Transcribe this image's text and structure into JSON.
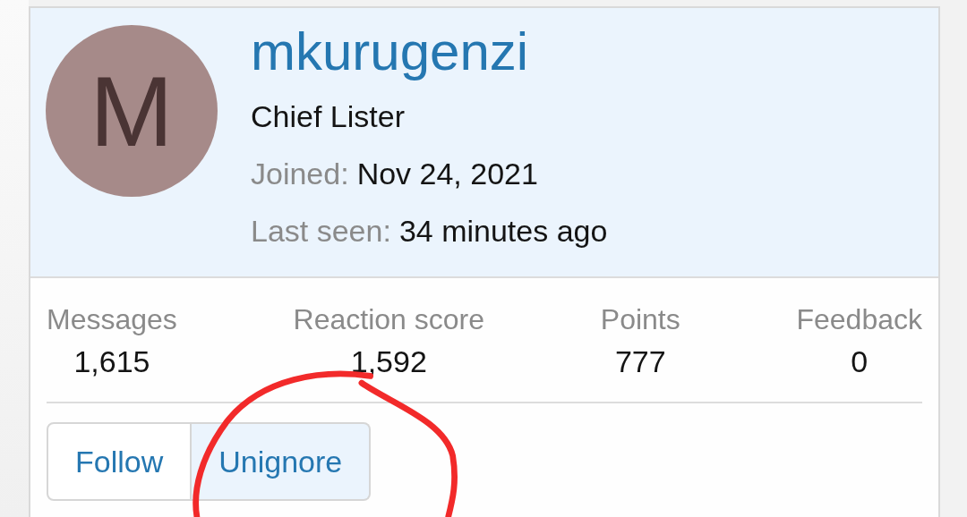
{
  "profile": {
    "avatar_letter": "M",
    "username": "mkurugenzi",
    "title": "Chief Lister",
    "details": [
      {
        "label": "Joined:",
        "value": "Nov 24, 2021"
      },
      {
        "label": "Last seen:",
        "value": "34 minutes ago"
      }
    ]
  },
  "stats": [
    {
      "label": "Messages",
      "value": "1,615"
    },
    {
      "label": "Reaction score",
      "value": "1,592"
    },
    {
      "label": "Points",
      "value": "777"
    },
    {
      "label": "Feedback",
      "value": "0"
    }
  ],
  "buttons": [
    {
      "label": "Follow",
      "selected": false
    },
    {
      "label": "Unignore",
      "selected": true
    }
  ]
}
